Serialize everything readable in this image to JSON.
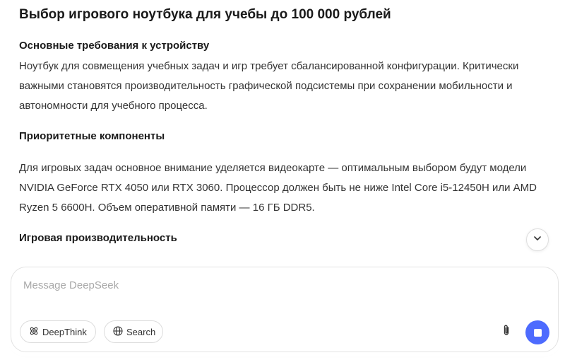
{
  "article": {
    "title": "Выбор игрового ноутбука для учебы до 100 000 рублей",
    "sections": [
      {
        "heading": "Основные требования к устройству",
        "lines": [
          "Ноутбук для совмещения учебных задач и игр требует сбалансированной конфигурации. Критически",
          "важными становятся производительность графической подсистемы при сохранении мобильности и",
          "автономности для учебного процесса."
        ]
      },
      {
        "heading": "Приоритетные компоненты",
        "lines": [
          "Для игровых задач основное внимание уделяется видеокарте — оптимальным выбором будут модели",
          "NVIDIA GeForce RTX 4050 или RTX 3060. Процессор должен быть не ниже Intel Core i5-12450H или AMD",
          "Ryzen 5 6600H. Объем оперативной памяти — 16 ГБ DDR5."
        ]
      },
      {
        "heading": "Игровая производительность",
        "lines": []
      }
    ]
  },
  "composer": {
    "placeholder": "Message DeepSeek",
    "deepthink_label": "DeepThink",
    "search_label": "Search"
  },
  "icons": {
    "scroll_down": "chevron-down-icon",
    "deepthink": "deepthink-icon",
    "search": "globe-icon",
    "attach": "paperclip-icon",
    "stop": "stop-icon"
  },
  "colors": {
    "accent": "#4d6bfe",
    "text": "#262626"
  }
}
